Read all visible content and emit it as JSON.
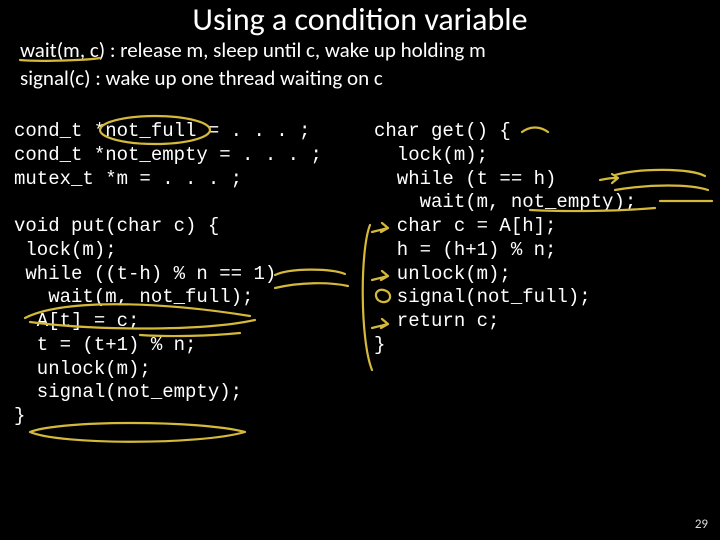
{
  "title": "Using a condition variable",
  "definitions": {
    "wait": "wait(m, c) : release m, sleep until c, wake up holding m",
    "signal": "signal(c) : wake up one thread waiting on c"
  },
  "code": {
    "left_decls": "cond_t *not_full = . . . ;\ncond_t *not_empty = . . . ;\nmutex_t *m = . . . ;",
    "left_put": "void put(char c) {\n lock(m);\n while ((t-h) % n == 1)\n   wait(m, not_full);\n  A[t] = c;\n  t = (t+1) % n;\n  unlock(m);\n  signal(not_empty);\n}",
    "right_get": "char get() {\n  lock(m);\n  while (t == h)\n    wait(m, not_empty);\n  char c = A[h];\n  h = (h+1) % n;\n  unlock(m);\n  signal(not_full);\n  return c;\n}"
  },
  "page_number": "29"
}
